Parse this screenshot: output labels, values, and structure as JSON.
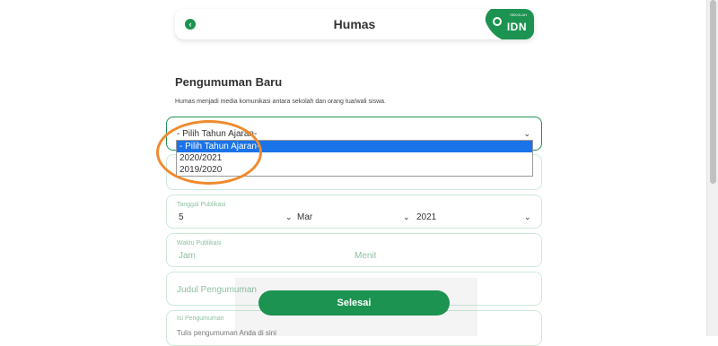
{
  "header": {
    "title": "Humas",
    "back_icon": "chevron-left-icon",
    "logo_small": "SEKOLAH",
    "logo_text": "IDN"
  },
  "section": {
    "title": "Pengumuman Baru",
    "description": "Humas menjadi media komunikasi antara sekolah dan orang tua/wali siswa."
  },
  "tahun_ajaran": {
    "value": "- Pilih Tahun Ajaran-",
    "options": [
      "- Pilih Tahun Ajaran-",
      "2020/2021",
      "2019/2020"
    ]
  },
  "tanggal": {
    "label": "Tanggal Publikasi",
    "day": "5",
    "month": "Mar",
    "year": "2021"
  },
  "waktu": {
    "label": "Waktu Publikasi",
    "jam_placeholder": "Jam",
    "menit_placeholder": "Menit"
  },
  "judul": {
    "placeholder": "Judul Pengumuman"
  },
  "isi": {
    "label": "Isi Pengumuman",
    "placeholder": "Tulis pengumuman Anda di sini"
  },
  "submit": {
    "label": "Selesai"
  },
  "colors": {
    "primary": "#1d9351",
    "annotation": "#f08a2c",
    "selected": "#1a73e8"
  }
}
